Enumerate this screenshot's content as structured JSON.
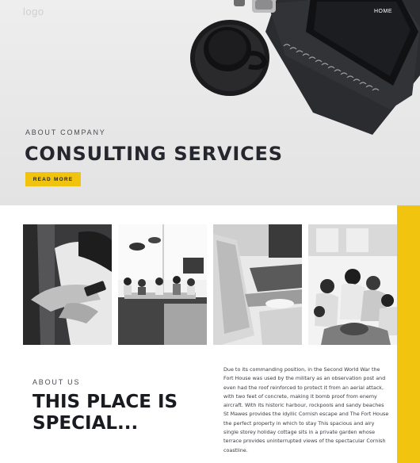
{
  "header": {
    "logo": "logo",
    "nav": {
      "home": "HOME"
    }
  },
  "hero": {
    "eyebrow": "ABOUT COMPANY",
    "title": "CONSULTING SERVICES",
    "cta_label": "READ MORE"
  },
  "gallery": {
    "photos": [
      {
        "icon": "hands-with-phone-photo"
      },
      {
        "icon": "office-meeting-photo"
      },
      {
        "icon": "laptop-desk-photo"
      },
      {
        "icon": "team-hands-together-photo"
      }
    ]
  },
  "about": {
    "eyebrow": "ABOUT US",
    "title": "THIS PLACE IS SPECIAL...",
    "body": "Due to its commanding position, in the Second World War the Fort House was used by the military as an observation post and even had the roof reinforced to protect it from an aerial attack, with two feet of concrete, making it bomb proof from enemy aircraft. With its historic harbour, rockpools and sandy beaches St Mawes provides the idyllic Cornish escape and The Fort House the perfect property in which to stay This spacious and airy single storey holiday cottage sits in a private garden whose terrace provides uninterrupted views of the spectacular Cornish coastline."
  },
  "colors": {
    "accent": "#f1c40f",
    "dark_text": "#1f2026"
  }
}
